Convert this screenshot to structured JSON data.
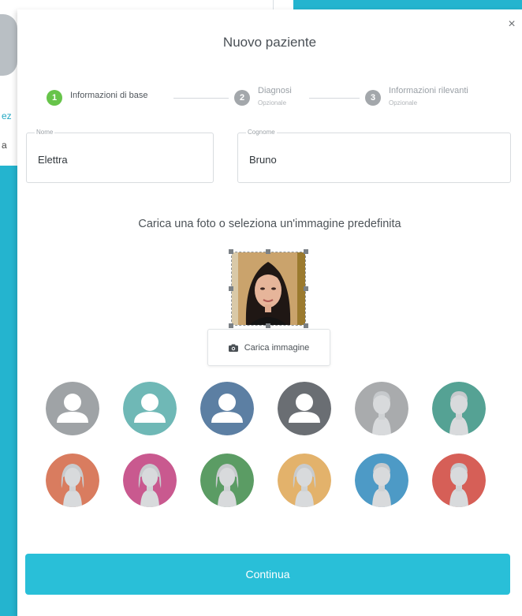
{
  "background": {
    "partial_text_1": "ez",
    "partial_text_2": "a"
  },
  "modal": {
    "title": "Nuovo paziente",
    "close_symbol": "×"
  },
  "stepper": {
    "steps": [
      {
        "number": "1",
        "label": "Informazioni di base",
        "sublabel": "",
        "state": "active"
      },
      {
        "number": "2",
        "label": "Diagnosi",
        "sublabel": "Opzionale",
        "state": "inactive"
      },
      {
        "number": "3",
        "label": "Informazioni rilevanti",
        "sublabel": "Opzionale",
        "state": "inactive"
      }
    ]
  },
  "form": {
    "first_name": {
      "label": "Nome",
      "value": "Elettra"
    },
    "last_name": {
      "label": "Cognome",
      "value": "Bruno"
    }
  },
  "photo_section": {
    "instruction": "Carica una foto o seleziona un'immagine predefinita",
    "upload_label": "Carica immagine",
    "upload_icon": "camera-icon"
  },
  "avatars": {
    "row1": [
      {
        "kind": "generic",
        "bg": "#9fa3a6"
      },
      {
        "kind": "generic",
        "bg": "#6fb8b6"
      },
      {
        "kind": "generic",
        "bg": "#5c7fa3"
      },
      {
        "kind": "generic",
        "bg": "#6a6e73"
      },
      {
        "kind": "man",
        "bg": "#a9abad"
      },
      {
        "kind": "man",
        "bg": "#55a294"
      }
    ],
    "row2": [
      {
        "kind": "woman",
        "bg": "#d97c5f"
      },
      {
        "kind": "woman",
        "bg": "#c9598f"
      },
      {
        "kind": "woman",
        "bg": "#5b9c64"
      },
      {
        "kind": "woman",
        "bg": "#e3b26b"
      },
      {
        "kind": "man",
        "bg": "#4d9ac6"
      },
      {
        "kind": "man",
        "bg": "#d65f57"
      }
    ]
  },
  "actions": {
    "continue_label": "Continua"
  },
  "colors": {
    "accent": "#29bfd8",
    "step_active": "#67c44a",
    "step_inactive": "#a3a7ab"
  }
}
